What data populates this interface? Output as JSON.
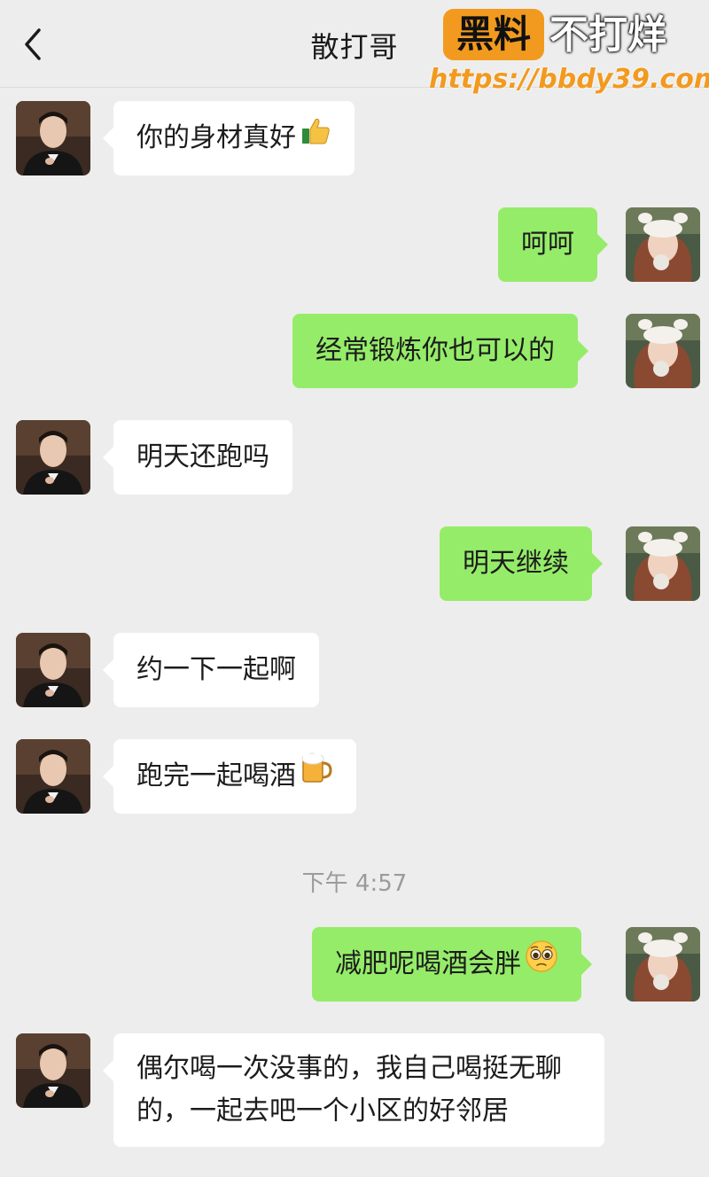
{
  "header": {
    "title": "散打哥",
    "back_icon": "chevron-left-icon"
  },
  "watermark": {
    "badge": "黑料",
    "text": "不打烊",
    "url": "https://bbdy39.com",
    "color": "#f29a1f"
  },
  "colors": {
    "incoming_bubble": "#ffffff",
    "outgoing_bubble": "#95ec69",
    "background": "#ededed"
  },
  "messages": [
    {
      "side": "in",
      "text": "你的身材真好",
      "emoji": "thumbs-up-icon"
    },
    {
      "side": "out",
      "text": "呵呵"
    },
    {
      "side": "out",
      "text": "经常锻炼你也可以的"
    },
    {
      "side": "in",
      "text": "明天还跑吗"
    },
    {
      "side": "out",
      "text": "明天继续"
    },
    {
      "side": "in",
      "text": "约一下一起啊"
    },
    {
      "side": "in",
      "text": "跑完一起喝酒",
      "emoji": "beer-mug-icon"
    },
    {
      "side": "out",
      "text": "减肥呢喝酒会胖",
      "emoji": "pleading-face-icon"
    },
    {
      "side": "in",
      "text": "偶尔喝一次没事的，我自己喝挺无聊的，一起去吧一个小区的好邻居"
    }
  ],
  "timestamp": "下午 4:57"
}
